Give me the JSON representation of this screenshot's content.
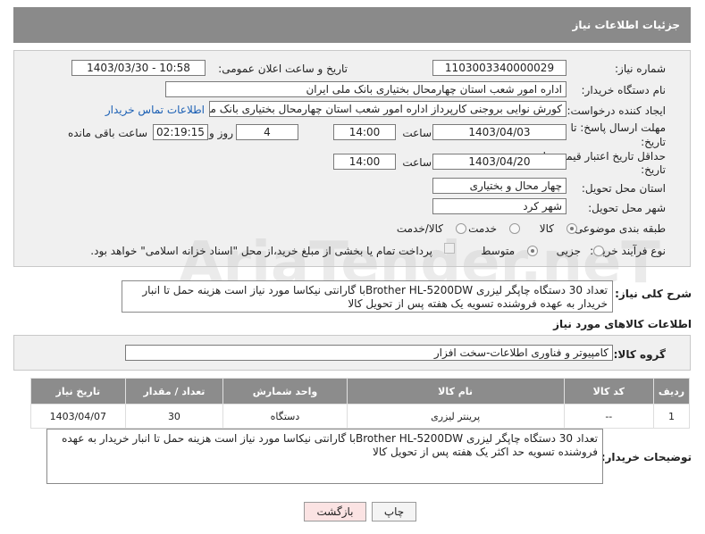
{
  "header": {
    "title": "جزئیات اطلاعات نیاز"
  },
  "watermark": "AriaTender.neT",
  "form": {
    "need_number_label": "شماره نیاز:",
    "need_number": "1103003340000029",
    "announce_label": "تاریخ و ساعت اعلان عمومی:",
    "announce_value": "1403/03/30 - 10:58",
    "buyer_org_label": "نام دستگاه خریدار:",
    "buyer_org": "اداره امور شعب استان چهارمحال بختیاری بانک ملی ایران",
    "creator_label": "ایجاد کننده درخواست:",
    "creator": "کورش نوایی بروجنی کارپرداز اداره امور شعب استان چهارمحال بختیاری بانک ملی ایران",
    "contact_link": "اطلاعات تماس خریدار",
    "deadline_label_1": "مهلت ارسال پاسخ: تا",
    "deadline_label_2": "تاریخ:",
    "deadline_date": "1403/04/03",
    "time_label": "ساعت",
    "deadline_time": "14:00",
    "days": "4",
    "days_label": "روز و",
    "remaining": "02:19:15",
    "remaining_label": "ساعت باقی مانده",
    "validity_label_1": "حداقل تاریخ اعتبار قیمت: تا",
    "validity_label_2": "تاریخ:",
    "validity_date": "1403/04/20",
    "validity_time": "14:00",
    "province_label": "استان محل تحویل:",
    "province": "چهار محال و بختیاری",
    "city_label": "شهر محل تحویل:",
    "city": "شهر کرد",
    "category_label": "طبقه بندی موضوعی:",
    "category_options": [
      "کالا",
      "خدمت",
      "کالا/خدمت"
    ],
    "process_label": "نوع فرآیند خرید :",
    "process_options": [
      "جزیی",
      "متوسط"
    ],
    "payment_note": "پرداخت تمام یا بخشی از مبلغ خرید،از محل \"اسناد خزانه اسلامی\" خواهد بود."
  },
  "summary": {
    "label": "شرح کلی نیاز:",
    "text": "تعداد 30 دستگاه چاپگر لیزری Brother HL-5200DWبا گارانتی نیکاسا مورد نیاز است هزینه حمل تا انبار خریدار به عهده فروشنده تسویه یک هفته پس از تحویل کالا"
  },
  "goods": {
    "section_title": "اطلاعات کالاهای مورد نیاز",
    "group_label": "گروه کالا:",
    "group_value": "کامپیوتر و فناوری اطلاعات-سخت افزار",
    "columns": [
      "ردیف",
      "کد کالا",
      "نام کالا",
      "واحد شمارش",
      "تعداد / مقدار",
      "تاریخ نیاز"
    ],
    "rows": [
      {
        "row": "1",
        "code": "--",
        "name": "پرینتر لیزری",
        "unit": "دستگاه",
        "qty": "30",
        "date": "1403/04/07"
      }
    ]
  },
  "buyer_notes": {
    "label": "توضیحات خریدار:",
    "text": "تعداد 30 دستگاه چاپگر لیزری Brother HL-5200DWبا گارانتی نیکاسا مورد نیاز است هزینه حمل تا انبار خریدار به عهده فروشنده تسویه حد اکثر یک هفته پس از تحویل کالا"
  },
  "buttons": {
    "print": "چاپ",
    "back": "بازگشت"
  },
  "colors": {
    "header_bg": "#8a8a8a",
    "panel_bg": "#f0f0f0",
    "link": "#1a5fb4",
    "back_button_bg": "#fbe3e3"
  }
}
